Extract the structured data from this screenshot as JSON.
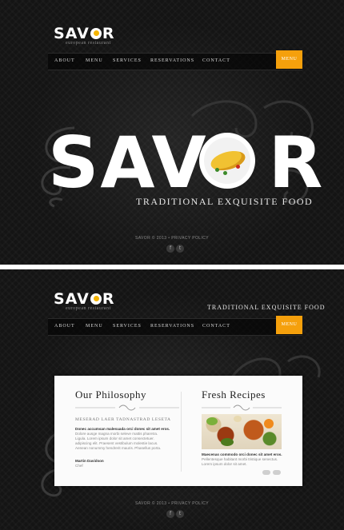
{
  "brand": {
    "logo_left": "SAV",
    "logo_right": "R",
    "tagline": "european restaurant"
  },
  "nav": {
    "items": [
      "ABOUT",
      "MENU",
      "SERVICES",
      "RESERVATIONS",
      "CONTACT"
    ],
    "menu_button": "MENU"
  },
  "hero": {
    "title_left": "SAV",
    "title_right": "R",
    "subtitle": "TRADITIONAL EXQUISITE FOOD"
  },
  "footer": {
    "text": "SAVOR © 2013 • PRIVACY POLICY",
    "facebook_glyph": "f",
    "twitter_glyph": "t"
  },
  "page2": {
    "header_tagline": "TRADITIONAL EXQUISITE FOOD",
    "philosophy": {
      "title": "Our Philosophy",
      "subhead": "MESERAD LAER TADNASTRAD LESETA",
      "lines": [
        "Donec accumsan malesuada orci donec sit amet eros.",
        "Dolore ausge magna morbi seleve mattis pharetra.",
        "Ligula. Lorem ipsum dolor sit amet consectetuer.",
        "adipiscing elit. Praesent vestibulum molestie lacus.",
        "Aenean nonummy hendrerit mauris. Phasellus porta."
      ],
      "author": "Martin Davidson",
      "role": "Chef"
    },
    "recipes": {
      "title": "Fresh Recipes",
      "lines": [
        "Maecenas commodo orci donec sit amet eros.",
        "Pellentesque habitant morbi tristique senectus.",
        "Lorem ipsum dolor sit amet."
      ]
    }
  },
  "colors": {
    "accent": "#f5a00c",
    "background": "#141414"
  },
  "icons": [
    "egg-icon",
    "facebook-icon",
    "twitter-icon",
    "ornament-icon",
    "swirl-decoration"
  ]
}
